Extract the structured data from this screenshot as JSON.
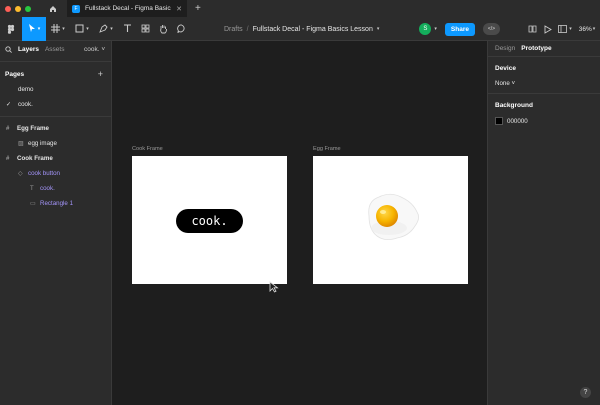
{
  "tab": {
    "title": "Fullstack Decal - Figma Basics Les",
    "close": "✕",
    "new": "+"
  },
  "toolbar": {
    "breadcrumb_drafts": "Drafts",
    "breadcrumb_sep": "/",
    "file_name": "Fullstack Decal - Figma Basics Lesson",
    "avatar_initial": "S",
    "share_label": "Share",
    "zoom": "36%"
  },
  "left_panel": {
    "tab_layers": "Layers",
    "tab_assets": "Assets",
    "page_selector": "cook. ˅",
    "pages_header": "Pages",
    "pages": [
      {
        "label": "demo",
        "selected": false
      },
      {
        "label": "cook.",
        "selected": true
      }
    ],
    "layers": [
      {
        "label": "Egg Frame",
        "type": "frame",
        "depth": 0
      },
      {
        "label": "egg image",
        "type": "image",
        "depth": 1
      },
      {
        "label": "Cook Frame",
        "type": "frame",
        "depth": 0
      },
      {
        "label": "cook button",
        "type": "component",
        "depth": 1
      },
      {
        "label": "cook.",
        "type": "text",
        "depth": 2
      },
      {
        "label": "Rectangle 1",
        "type": "rectangle",
        "depth": 2
      }
    ]
  },
  "right_panel": {
    "tab_design": "Design",
    "tab_prototype": "Prototype",
    "device_label": "Device",
    "device_value": "None ˅",
    "background_label": "Background",
    "background_value": "000000",
    "help": "?"
  },
  "canvas": {
    "cook_frame_label": "Cook Frame",
    "egg_frame_label": "Egg Frame",
    "cook_button_text": "cook."
  },
  "colors": {
    "accent": "#0d99ff",
    "component_purple": "#a394f9",
    "avatar_green": "#14ae5c"
  }
}
